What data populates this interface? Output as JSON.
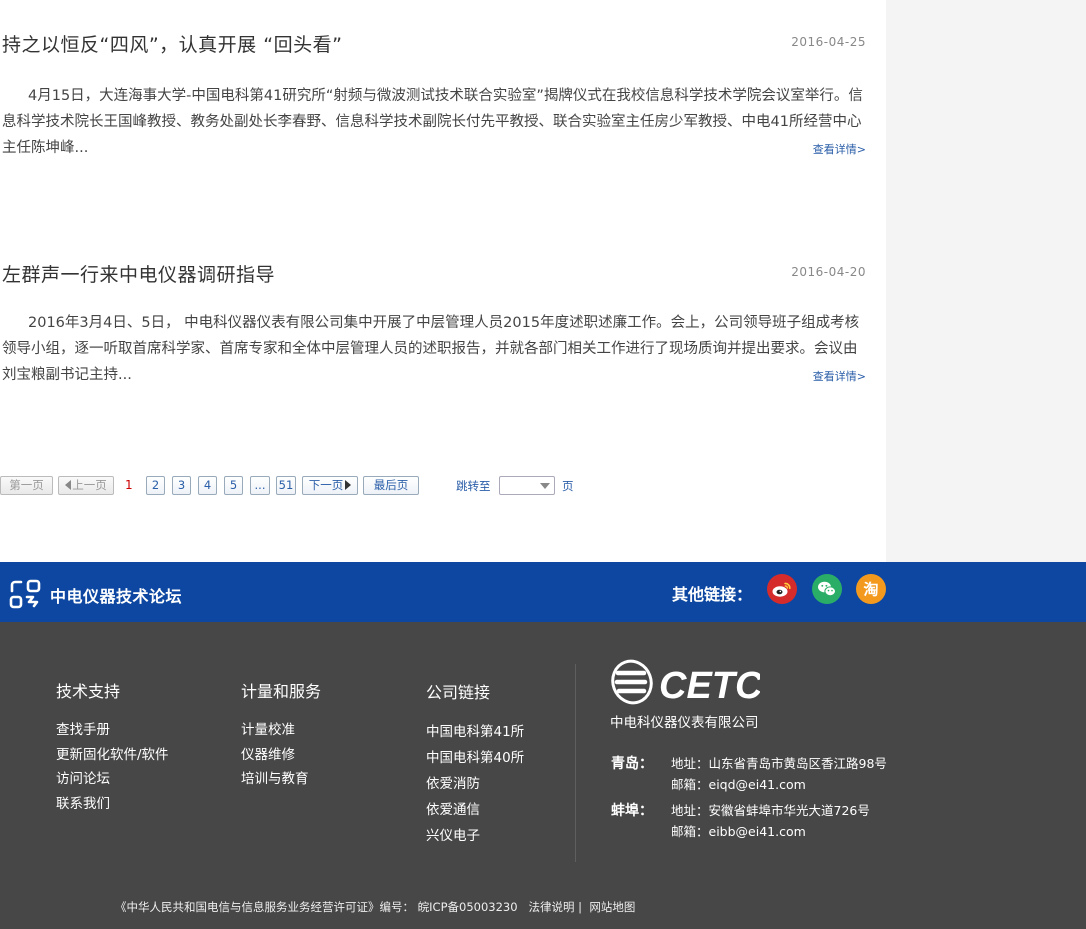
{
  "articles": [
    {
      "title": "持之以恒反“四风”，认真开展  “回头看”",
      "date": "2016-04-25",
      "summary": "4月15日，大连海事大学-中国电科第41研究所“射频与微波测试技术联合实验室”揭牌仪式在我校信息科学技术学院会议室举行。信息科学技术院长王国峰教授、教务处副处长李春野、信息科学技术副院长付先平教授、联合实验室主任房少军教授、中电41所经营中心主任陈坤峰...",
      "more": "查看详情>"
    },
    {
      "title": "左群声一行来中电仪器调研指导",
      "date": "2016-04-20",
      "summary": "2016年3月4日、5日， 中电科仪器仪表有限公司集中开展了中层管理人员2015年度述职述廉工作。会上，公司领导班子组成考核领导小组，逐一听取首席科学家、首席专家和全体中层管理人员的述职报告，并就各部门相关工作进行了现场质询并提出要求。会议由刘宝粮副书记主持...",
      "more": "查看详情>"
    }
  ],
  "pagination": {
    "first": "第一页",
    "prev": "上一页",
    "current": "1",
    "pages": [
      "2",
      "3",
      "4",
      "5",
      "...",
      "51"
    ],
    "next": "下一页",
    "last": "最后页",
    "jump_label": "跳转至",
    "jump_unit": "页"
  },
  "band": {
    "forum_title": "中电仪器技术论坛",
    "other_links_label": "其他链接：",
    "social": [
      "weibo-icon",
      "wechat-icon",
      "taobao-icon"
    ],
    "taobao_glyph": "淘",
    "colors": {
      "band": "#0d47a1",
      "weibo": "#d52c2b",
      "wechat": "#2aae67",
      "taobao": "#f39a1e"
    }
  },
  "footer": {
    "col1": {
      "title": "技术支持",
      "links": [
        "查找手册",
        "更新固化软件/软件",
        "访问论坛",
        "联系我们"
      ]
    },
    "col2": {
      "title": "计量和服务",
      "links": [
        "计量校准",
        "仪器维修",
        "培训与教育"
      ]
    },
    "col3": {
      "title": "公司链接",
      "links": [
        "中国电科第41所",
        "中国电科第40所",
        "依爱消防",
        "依爱通信",
        "兴仪电子"
      ]
    },
    "logo_text": "CETC",
    "company": "中电科仪器仪表有限公司",
    "offices": [
      {
        "city": "青岛：",
        "address": "地址：山东省青岛市黄岛区香江路98号",
        "email": "邮箱：eiqd@ei41.com"
      },
      {
        "city": "蚌埠：",
        "address": "地址：安徽省蚌埠市华光大道726号",
        "email": "邮箱：eibb@ei41.com"
      }
    ],
    "license": "《中华人民共和国电信与信息服务业务经营许可证》编号：",
    "icp": "皖ICP备05003230",
    "legal": "法律说明",
    "separator": "|",
    "sitemap": "网站地图"
  }
}
